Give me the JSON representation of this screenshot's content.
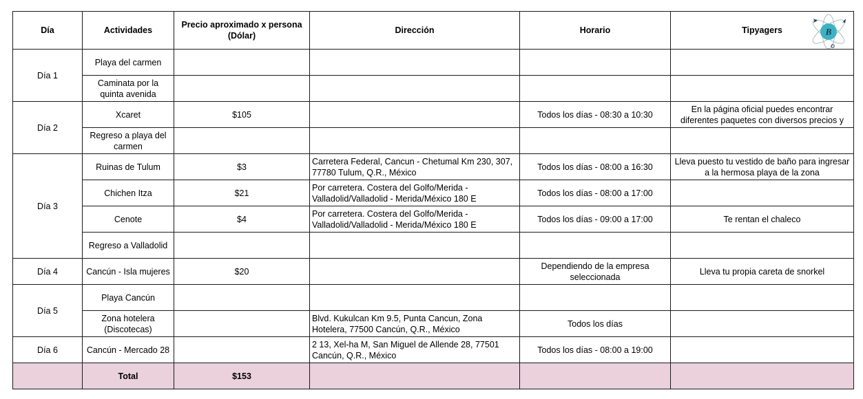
{
  "headers": {
    "dia": "Día",
    "actividades": "Actividades",
    "precio": "Precio aproximado x persona (Dólar)",
    "direccion": "Dirección",
    "horario": "Horario",
    "tipyagers": "Tipyagers"
  },
  "logo": {
    "letter": "B",
    "icon": "travel-logo-icon",
    "accent": "#3cb3c3"
  },
  "days": [
    "Día 1",
    "Día 2",
    "Día 3",
    "Día 4",
    "Día 5",
    "Día 6"
  ],
  "rows": [
    {
      "actividad": "Playa del carmen",
      "precio": "",
      "direccion": "",
      "horario": "",
      "tip": ""
    },
    {
      "actividad": "Caminata por la quinta avenida",
      "precio": "",
      "direccion": "",
      "horario": "",
      "tip": ""
    },
    {
      "actividad": "Xcaret",
      "precio": "$105",
      "direccion": "",
      "horario": "Todos los días - 08:30 a 10:30",
      "tip": "En la página oficial puedes encontrar diferentes paquetes con diversos precios y"
    },
    {
      "actividad": "Regreso a playa del carmen",
      "precio": "",
      "direccion": "",
      "horario": "",
      "tip": ""
    },
    {
      "actividad": "Ruinas de Tulum",
      "precio": "$3",
      "direccion": "Carretera Federal, Cancun - Chetumal Km 230, 307, 77780 Tulum, Q.R., México",
      "horario": "Todos los días - 08:00 a 16:30",
      "tip": "Lleva puesto tu vestido de baño para ingresar a la hermosa playa de la zona"
    },
    {
      "actividad": "Chichen Itza",
      "precio": "$21",
      "direccion": "Por carretera. Costera del Golfo/Merida - Valladolid/Valladolid - Merida/México 180 E",
      "horario": "Todos los días - 08:00 a 17:00",
      "tip": ""
    },
    {
      "actividad": "Cenote",
      "precio": "$4",
      "direccion": "Por carretera. Costera del Golfo/Merida - Valladolid/Valladolid - Merida/México 180 E",
      "horario": "Todos los días - 09:00 a 17:00",
      "tip": "Te rentan el chaleco"
    },
    {
      "actividad": "Regreso a Valladolid",
      "precio": "",
      "direccion": "",
      "horario": "",
      "tip": ""
    },
    {
      "actividad": "Cancún - Isla mujeres",
      "precio": "$20",
      "direccion": "",
      "horario": "Dependiendo de la empresa seleccionada",
      "tip": "Lleva tu propia careta de snorkel"
    },
    {
      "actividad": "Playa Cancún",
      "precio": "",
      "direccion": "",
      "horario": "",
      "tip": ""
    },
    {
      "actividad": "Zona hotelera (Discotecas)",
      "precio": "",
      "direccion": "Blvd. Kukulcan Km 9.5, Punta Cancun, Zona Hotelera, 77500 Cancún, Q.R., México",
      "horario": "Todos los días",
      "tip": ""
    },
    {
      "actividad": "Cancún - Mercado 28",
      "precio": "",
      "direccion": "2 13, Xel-ha M, San Miguel de Allende 28, 77501 Cancún, Q.R., México",
      "horario": "Todos los días - 08:00 a 19:00",
      "tip": ""
    }
  ],
  "total": {
    "label": "Total",
    "precio": "$153"
  }
}
